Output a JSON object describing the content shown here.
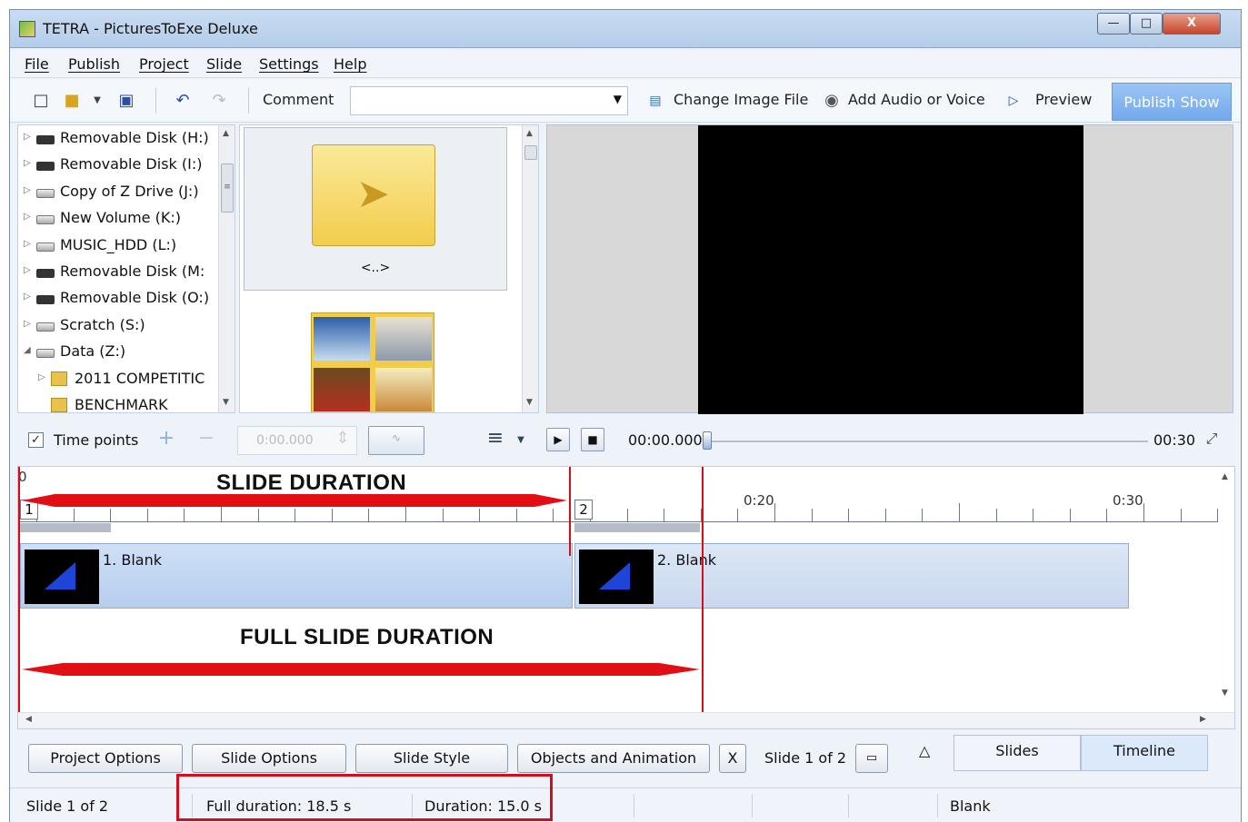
{
  "window": {
    "title": "TETRA - PicturesToExe Deluxe",
    "min": "—",
    "max": "□",
    "close": "X"
  },
  "menu": [
    "File",
    "Publish",
    "Project",
    "Slide",
    "Settings",
    "Help"
  ],
  "toolbar": {
    "comment_label": "Comment",
    "comment_value": "",
    "change_image": "Change Image File",
    "add_audio": "Add Audio or Voice",
    "preview": "Preview",
    "publish_show": "Publish Show"
  },
  "tree": [
    {
      "label": "Removable Disk (H:)",
      "icon": "removable-disk",
      "arrow": "▷"
    },
    {
      "label": "Removable Disk (I:)",
      "icon": "removable-disk",
      "arrow": "▷"
    },
    {
      "label": "Copy of Z Drive (J:)",
      "icon": "hard-drive",
      "arrow": "▷"
    },
    {
      "label": "New Volume (K:)",
      "icon": "hard-drive",
      "arrow": "▷"
    },
    {
      "label": "MUSIC_HDD (L:)",
      "icon": "hard-drive",
      "arrow": "▷"
    },
    {
      "label": "Removable Disk (M:",
      "icon": "removable-disk",
      "arrow": "▷"
    },
    {
      "label": "Removable Disk (O:)",
      "icon": "removable-disk",
      "arrow": "▷"
    },
    {
      "label": "Scratch (S:)",
      "icon": "hard-drive",
      "arrow": "▷"
    },
    {
      "label": "Data (Z:)",
      "icon": "hard-drive",
      "arrow": "◢"
    },
    {
      "label": "2011 COMPETITIC",
      "icon": "folder",
      "arrow": "▷"
    },
    {
      "label": "BENCHMARK",
      "icon": "folder",
      "arrow": ""
    }
  ],
  "thumbs": {
    "parent_label": "<..>"
  },
  "timeline_controls": {
    "time_points_label": "Time points",
    "time_points_checked": "✓",
    "time_input": "0:00.000",
    "current_time": "00:00.000",
    "end_time": "00:30"
  },
  "timeline": {
    "ruler_labels": {
      "start": "0",
      "t20": "0:20",
      "t30": "0:30"
    },
    "slide_numbers": [
      "1",
      "2"
    ],
    "slides": [
      {
        "name": "1. Blank"
      },
      {
        "name": "2. Blank"
      }
    ],
    "annotations": {
      "slide_duration": "SLIDE DURATION",
      "full_slide_duration": "FULL SLIDE DURATION"
    }
  },
  "bottom": {
    "project_options": "Project Options",
    "slide_options": "Slide Options",
    "slide_style": "Slide Style",
    "objects_animation": "Objects and Animation",
    "x": "X",
    "slide_count": "Slide 1 of 2",
    "tab_slides": "Slides",
    "tab_timeline": "Timeline",
    "up_arrow": "△"
  },
  "status": {
    "slide": "Slide 1 of 2",
    "full_duration": "Full duration: 18.5 s",
    "duration": "Duration: 15.0 s",
    "name": "Blank"
  },
  "colors": {
    "annotation_red": "#e30e14",
    "accent_blue": "#73a9ec"
  }
}
